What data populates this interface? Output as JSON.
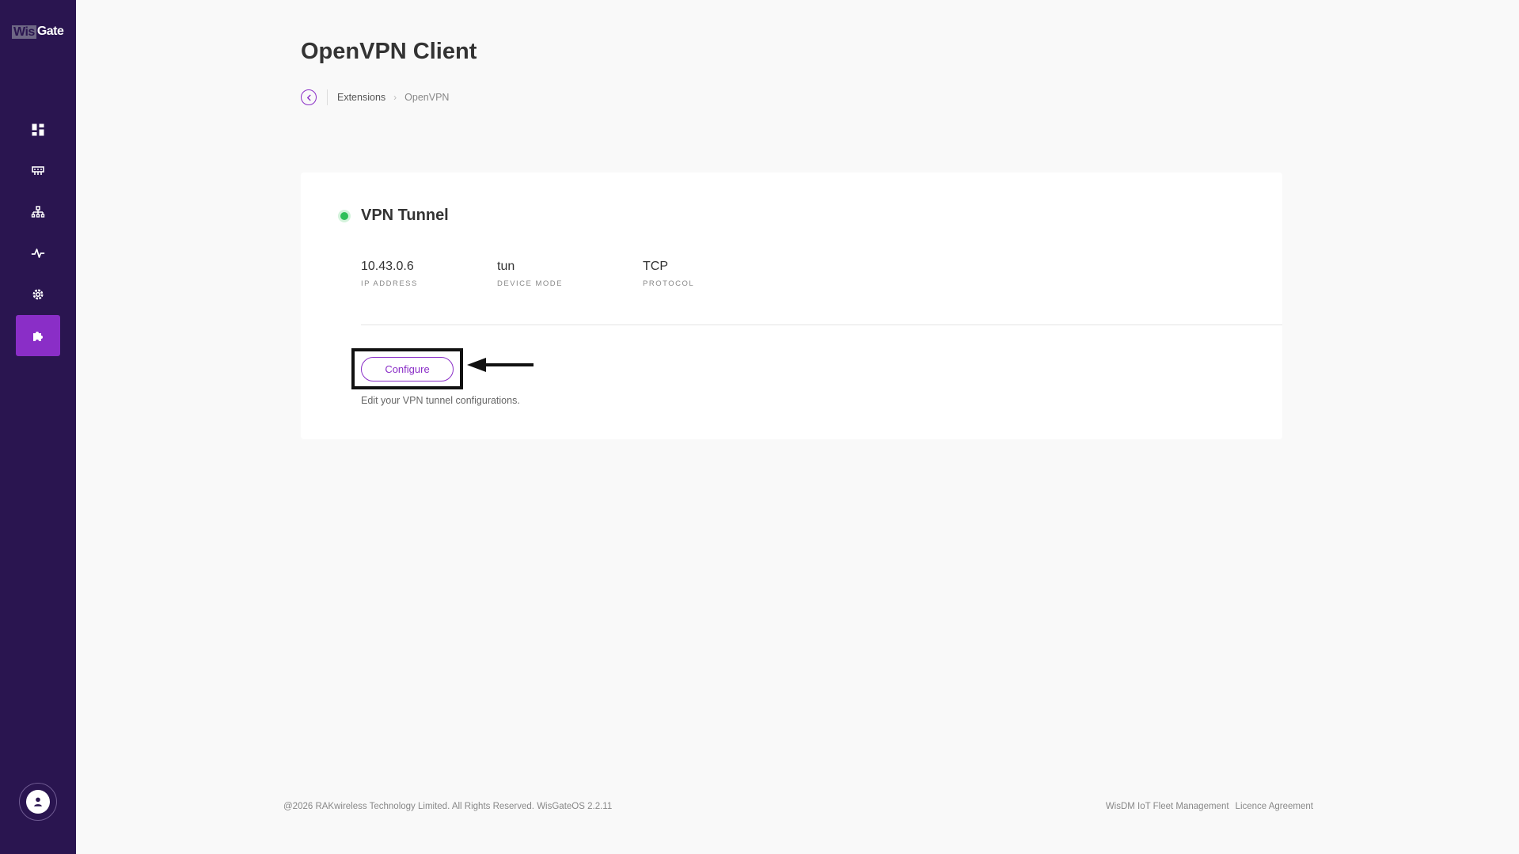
{
  "sidebar": {
    "logo": {
      "part1": "Wis",
      "part2": "Gate"
    },
    "items": [
      {
        "icon": "dashboard-icon"
      },
      {
        "icon": "gateway-icon"
      },
      {
        "icon": "network-icon"
      },
      {
        "icon": "activity-icon"
      },
      {
        "icon": "settings-icon"
      },
      {
        "icon": "extensions-puzzle-icon",
        "active": true
      }
    ],
    "avatar_icon": "user-icon"
  },
  "page": {
    "title": "OpenVPN Client"
  },
  "breadcrumb": {
    "items": [
      "Extensions",
      "OpenVPN"
    ]
  },
  "card": {
    "title": "VPN Tunnel",
    "status_color": "#2fbf5a",
    "fields": [
      {
        "value": "10.43.0.6",
        "label": "IP ADDRESS"
      },
      {
        "value": "tun",
        "label": "DEVICE MODE"
      },
      {
        "value": "TCP",
        "label": "PROTOCOL"
      }
    ],
    "configure_label": "Configure",
    "helper_text": "Edit your VPN tunnel configurations."
  },
  "footer": {
    "copyright": "@2026 RAKwireless Technology Limited. All Rights Reserved. WisGateOS 2.2.11",
    "links": [
      "WisDM IoT Fleet Management",
      "Licence Agreement"
    ]
  },
  "colors": {
    "sidebar_bg": "#2a1550",
    "accent": "#8a2ec7"
  }
}
